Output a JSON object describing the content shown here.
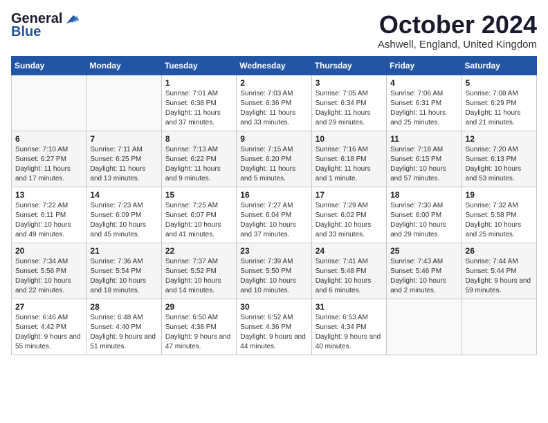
{
  "logo": {
    "line1": "General",
    "line2": "Blue"
  },
  "title": "October 2024",
  "location": "Ashwell, England, United Kingdom",
  "days_header": [
    "Sunday",
    "Monday",
    "Tuesday",
    "Wednesday",
    "Thursday",
    "Friday",
    "Saturday"
  ],
  "weeks": [
    [
      {
        "day": "",
        "info": ""
      },
      {
        "day": "",
        "info": ""
      },
      {
        "day": "1",
        "info": "Sunrise: 7:01 AM\nSunset: 6:38 PM\nDaylight: 11 hours and 37 minutes."
      },
      {
        "day": "2",
        "info": "Sunrise: 7:03 AM\nSunset: 6:36 PM\nDaylight: 11 hours and 33 minutes."
      },
      {
        "day": "3",
        "info": "Sunrise: 7:05 AM\nSunset: 6:34 PM\nDaylight: 11 hours and 29 minutes."
      },
      {
        "day": "4",
        "info": "Sunrise: 7:06 AM\nSunset: 6:31 PM\nDaylight: 11 hours and 25 minutes."
      },
      {
        "day": "5",
        "info": "Sunrise: 7:08 AM\nSunset: 6:29 PM\nDaylight: 11 hours and 21 minutes."
      }
    ],
    [
      {
        "day": "6",
        "info": "Sunrise: 7:10 AM\nSunset: 6:27 PM\nDaylight: 11 hours and 17 minutes."
      },
      {
        "day": "7",
        "info": "Sunrise: 7:11 AM\nSunset: 6:25 PM\nDaylight: 11 hours and 13 minutes."
      },
      {
        "day": "8",
        "info": "Sunrise: 7:13 AM\nSunset: 6:22 PM\nDaylight: 11 hours and 9 minutes."
      },
      {
        "day": "9",
        "info": "Sunrise: 7:15 AM\nSunset: 6:20 PM\nDaylight: 11 hours and 5 minutes."
      },
      {
        "day": "10",
        "info": "Sunrise: 7:16 AM\nSunset: 6:18 PM\nDaylight: 11 hours and 1 minute."
      },
      {
        "day": "11",
        "info": "Sunrise: 7:18 AM\nSunset: 6:15 PM\nDaylight: 10 hours and 57 minutes."
      },
      {
        "day": "12",
        "info": "Sunrise: 7:20 AM\nSunset: 6:13 PM\nDaylight: 10 hours and 53 minutes."
      }
    ],
    [
      {
        "day": "13",
        "info": "Sunrise: 7:22 AM\nSunset: 6:11 PM\nDaylight: 10 hours and 49 minutes."
      },
      {
        "day": "14",
        "info": "Sunrise: 7:23 AM\nSunset: 6:09 PM\nDaylight: 10 hours and 45 minutes."
      },
      {
        "day": "15",
        "info": "Sunrise: 7:25 AM\nSunset: 6:07 PM\nDaylight: 10 hours and 41 minutes."
      },
      {
        "day": "16",
        "info": "Sunrise: 7:27 AM\nSunset: 6:04 PM\nDaylight: 10 hours and 37 minutes."
      },
      {
        "day": "17",
        "info": "Sunrise: 7:29 AM\nSunset: 6:02 PM\nDaylight: 10 hours and 33 minutes."
      },
      {
        "day": "18",
        "info": "Sunrise: 7:30 AM\nSunset: 6:00 PM\nDaylight: 10 hours and 29 minutes."
      },
      {
        "day": "19",
        "info": "Sunrise: 7:32 AM\nSunset: 5:58 PM\nDaylight: 10 hours and 25 minutes."
      }
    ],
    [
      {
        "day": "20",
        "info": "Sunrise: 7:34 AM\nSunset: 5:56 PM\nDaylight: 10 hours and 22 minutes."
      },
      {
        "day": "21",
        "info": "Sunrise: 7:36 AM\nSunset: 5:54 PM\nDaylight: 10 hours and 18 minutes."
      },
      {
        "day": "22",
        "info": "Sunrise: 7:37 AM\nSunset: 5:52 PM\nDaylight: 10 hours and 14 minutes."
      },
      {
        "day": "23",
        "info": "Sunrise: 7:39 AM\nSunset: 5:50 PM\nDaylight: 10 hours and 10 minutes."
      },
      {
        "day": "24",
        "info": "Sunrise: 7:41 AM\nSunset: 5:48 PM\nDaylight: 10 hours and 6 minutes."
      },
      {
        "day": "25",
        "info": "Sunrise: 7:43 AM\nSunset: 5:46 PM\nDaylight: 10 hours and 2 minutes."
      },
      {
        "day": "26",
        "info": "Sunrise: 7:44 AM\nSunset: 5:44 PM\nDaylight: 9 hours and 59 minutes."
      }
    ],
    [
      {
        "day": "27",
        "info": "Sunrise: 6:46 AM\nSunset: 4:42 PM\nDaylight: 9 hours and 55 minutes."
      },
      {
        "day": "28",
        "info": "Sunrise: 6:48 AM\nSunset: 4:40 PM\nDaylight: 9 hours and 51 minutes."
      },
      {
        "day": "29",
        "info": "Sunrise: 6:50 AM\nSunset: 4:38 PM\nDaylight: 9 hours and 47 minutes."
      },
      {
        "day": "30",
        "info": "Sunrise: 6:52 AM\nSunset: 4:36 PM\nDaylight: 9 hours and 44 minutes."
      },
      {
        "day": "31",
        "info": "Sunrise: 6:53 AM\nSunset: 4:34 PM\nDaylight: 9 hours and 40 minutes."
      },
      {
        "day": "",
        "info": ""
      },
      {
        "day": "",
        "info": ""
      }
    ]
  ]
}
